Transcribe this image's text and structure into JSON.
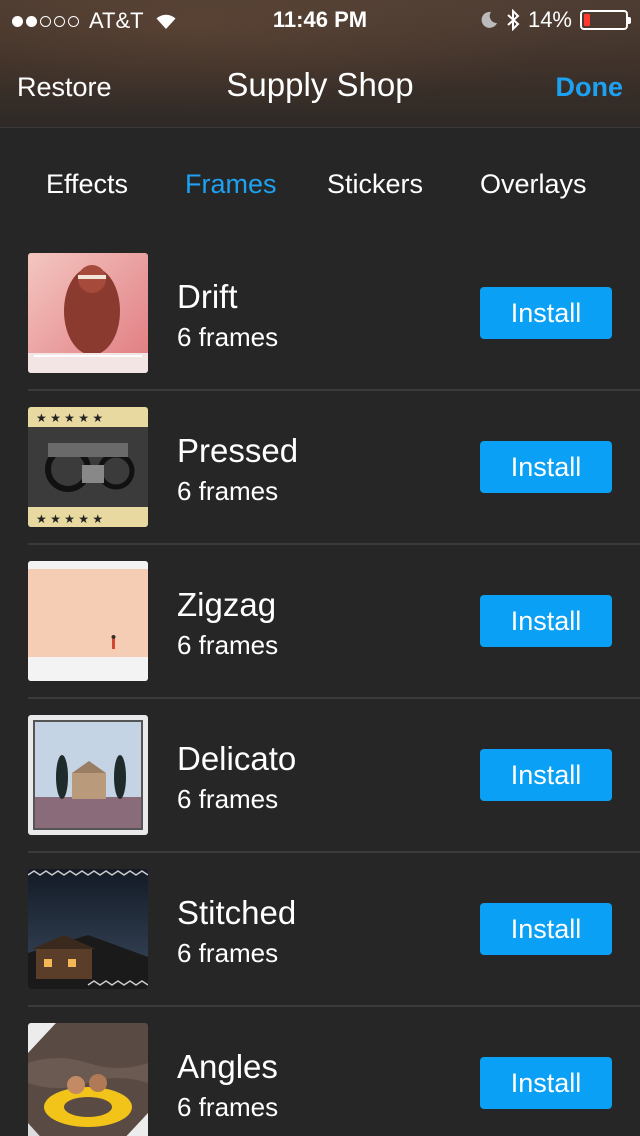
{
  "status_bar": {
    "signal_full": 2,
    "signal_total": 5,
    "carrier": "AT&T",
    "time": "11:46 PM",
    "battery": "14%",
    "battery_level": 0.14,
    "icons": [
      "wifi-icon",
      "moon-icon",
      "bluetooth-icon",
      "battery-icon"
    ]
  },
  "nav": {
    "left": "Restore",
    "title": "Supply Shop",
    "right": "Done"
  },
  "tabs": [
    {
      "label": "Effects",
      "active": false
    },
    {
      "label": "Frames",
      "active": true
    },
    {
      "label": "Stickers",
      "active": false
    },
    {
      "label": "Overlays",
      "active": false
    }
  ],
  "items": [
    {
      "title": "Drift",
      "subtitle": "6 frames",
      "button": "Install"
    },
    {
      "title": "Pressed",
      "subtitle": "6 frames",
      "button": "Install"
    },
    {
      "title": "Zigzag",
      "subtitle": "6 frames",
      "button": "Install"
    },
    {
      "title": "Delicato",
      "subtitle": "6 frames",
      "button": "Install"
    },
    {
      "title": "Stitched",
      "subtitle": "6 frames",
      "button": "Install"
    },
    {
      "title": "Angles",
      "subtitle": "6 frames",
      "button": "Install"
    }
  ],
  "colors": {
    "accent": "#1da1f2",
    "button": "#0aa0f5",
    "background": "#262626",
    "battery_low": "#ff3b30"
  }
}
